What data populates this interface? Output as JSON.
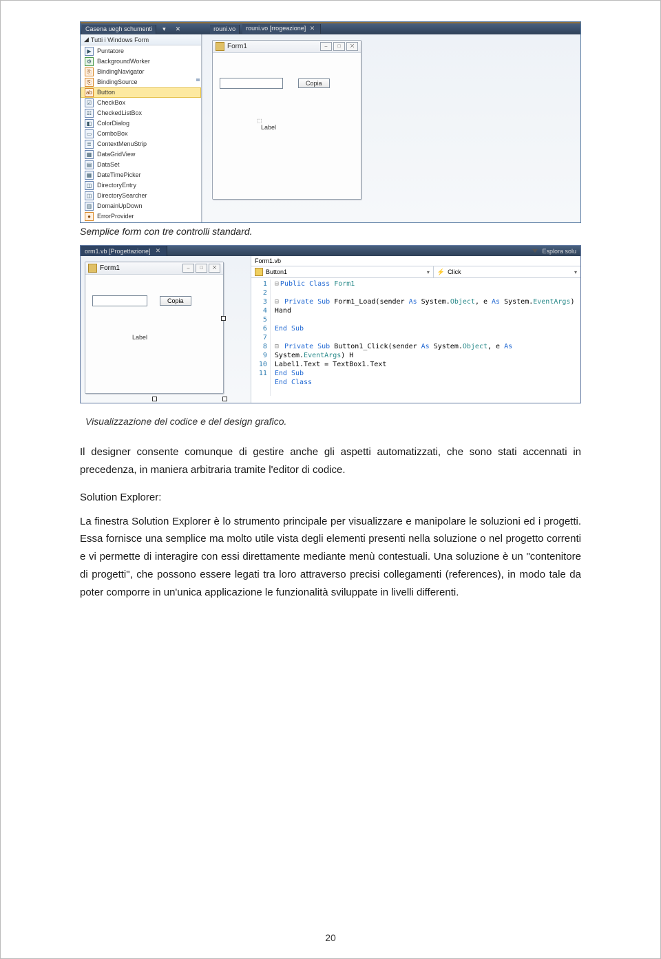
{
  "screenshot1": {
    "toolbox_tab_garbled": "Casena uegh schumenti",
    "tab_form": "rouni.vo",
    "tab_form_design": "rouni.vo [rrogeazione]",
    "toolbox_header": "Tutti i Windows Form",
    "items": [
      "Puntatore",
      "BackgroundWorker",
      "BindingNavigator",
      "BindingSource",
      "Button",
      "CheckBox",
      "CheckedListBox",
      "ColorDialog",
      "ComboBox",
      "ContextMenuStrip",
      "DataGridView",
      "DataSet",
      "DateTimePicker",
      "DirectoryEntry",
      "DirectorySearcher",
      "DomainUpDown",
      "ErrorProvider"
    ],
    "selected_index": 4,
    "form_title": "Form1",
    "copia_btn": "Copia",
    "label_text": "Label"
  },
  "caption1": "Semplice form con tre controlli standard.",
  "screenshot2": {
    "left_tab": "orm1.vb [Progettazione]",
    "explorer_label": "Esplora solu",
    "form_title": "Form1",
    "copia_btn": "Copia",
    "label_text": "Label",
    "code_file": "Form1.vb",
    "dropdown_object": "Button1",
    "dropdown_event": "Click",
    "code_lines": [
      {
        "n": "1",
        "plain": "",
        "tokens": [
          {
            "t": "Public Class",
            "c": "kw"
          },
          {
            "t": " Form1",
            "c": "typ"
          }
        ],
        "outline": "⊟"
      },
      {
        "n": "2",
        "plain": "",
        "tokens": []
      },
      {
        "n": "3",
        "plain": "",
        "tokens": [
          {
            "t": "    ",
            "c": ""
          },
          {
            "t": "Private Sub",
            "c": "kw"
          },
          {
            "t": " Form1_Load(",
            "c": ""
          },
          {
            "t": "sender ",
            "c": ""
          },
          {
            "t": "As",
            "c": "kw"
          },
          {
            "t": " System.",
            "c": ""
          },
          {
            "t": "Object",
            "c": "typ"
          },
          {
            "t": ", e ",
            "c": ""
          },
          {
            "t": "As",
            "c": "kw"
          },
          {
            "t": " System.",
            "c": ""
          },
          {
            "t": "EventArgs",
            "c": "typ"
          },
          {
            "t": ") Hand",
            "c": ""
          }
        ],
        "outline": "⊟"
      },
      {
        "n": "4",
        "plain": "",
        "tokens": []
      },
      {
        "n": "5",
        "plain": "",
        "tokens": [
          {
            "t": "    ",
            "c": ""
          },
          {
            "t": "End Sub",
            "c": "kw"
          }
        ]
      },
      {
        "n": "6",
        "plain": "",
        "tokens": []
      },
      {
        "n": "7",
        "plain": "",
        "tokens": [
          {
            "t": "    ",
            "c": ""
          },
          {
            "t": "Private Sub",
            "c": "kw"
          },
          {
            "t": " Button1_Click(",
            "c": ""
          },
          {
            "t": "sender ",
            "c": ""
          },
          {
            "t": "As",
            "c": "kw"
          },
          {
            "t": " System.",
            "c": ""
          },
          {
            "t": "Object",
            "c": "typ"
          },
          {
            "t": ", e ",
            "c": ""
          },
          {
            "t": "As",
            "c": "kw"
          },
          {
            "t": " System.",
            "c": ""
          },
          {
            "t": "EventArgs",
            "c": "typ"
          },
          {
            "t": ") H",
            "c": ""
          }
        ],
        "outline": "⊟"
      },
      {
        "n": "8",
        "plain": "",
        "tokens": [
          {
            "t": "        Label1.Text = TextBox1.Text",
            "c": ""
          }
        ]
      },
      {
        "n": "9",
        "plain": "",
        "tokens": [
          {
            "t": "    ",
            "c": ""
          },
          {
            "t": "End Sub",
            "c": "kw"
          }
        ]
      },
      {
        "n": "10",
        "plain": "",
        "tokens": [
          {
            "t": "End Class",
            "c": "kw"
          }
        ]
      },
      {
        "n": "11",
        "plain": "",
        "tokens": []
      }
    ]
  },
  "caption2": "Visualizzazione del codice e del design grafico.",
  "para1": "Il designer consente comunque di gestire anche gli aspetti automatizzati, che sono stati accennati in precedenza, in maniera arbitraria tramite l'editor di codice.",
  "section_head": "Solution Explorer:",
  "para2": "La finestra Solution Explorer è lo strumento principale per visualizzare e manipolare le soluzioni ed i progetti. Essa fornisce una semplice ma molto utile vista degli elementi presenti nella soluzione o nel progetto correnti e vi permette di interagire con essi direttamente mediante menù contestuali. Una soluzione è un \"contenitore di progetti\", che possono essere legati tra loro attraverso precisi collegamenti (references), in modo tale da poter comporre in un'unica applicazione le funzionalità sviluppate in livelli differenti.",
  "page_number": "20"
}
